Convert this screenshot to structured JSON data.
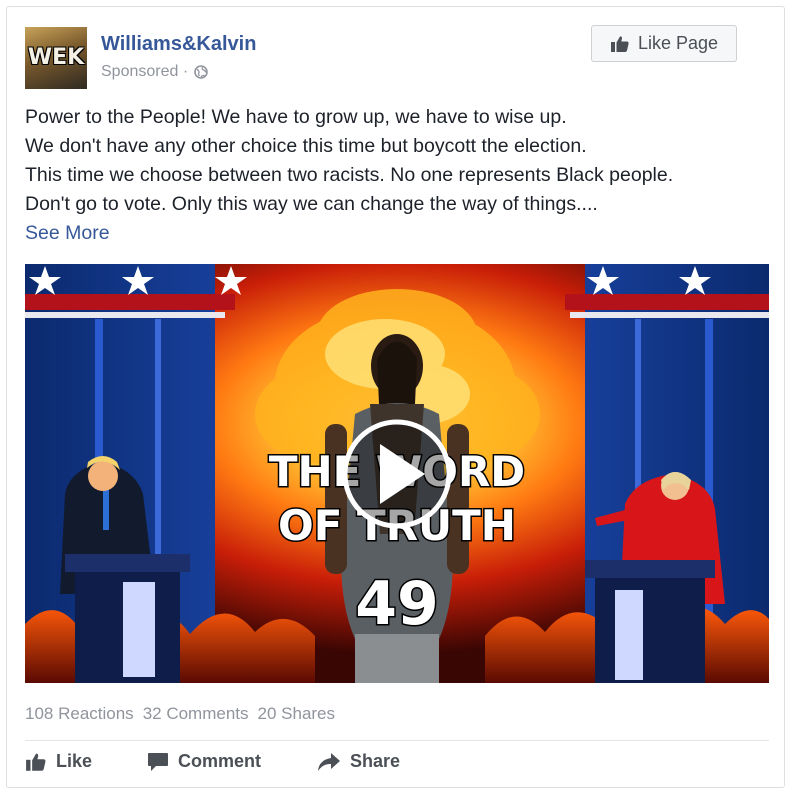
{
  "post": {
    "page_name": "Williams&Kalvin",
    "avatar_text": "WEK",
    "sponsored_label": "Sponsored ·",
    "like_page_label": "Like Page",
    "text_lines": [
      "Power to the People! We have to grow up, we have to wise up.",
      "We don't have any other choice this time but boycott the election.",
      "This time we choose between two racists. No one represents Black people.",
      "Don't go to vote. Only this way we can change the way of things...."
    ],
    "see_more_label": "See More",
    "video": {
      "title_line1": "THE WORD",
      "title_line2": "OF TRUTH",
      "episode": "49"
    },
    "counts": {
      "reactions": "108 Reactions",
      "comments": "32 Comments",
      "shares": "20 Shares"
    },
    "actions": {
      "like": "Like",
      "comment": "Comment",
      "share": "Share"
    }
  },
  "colors": {
    "link_blue": "#365899",
    "meta_gray": "#90949c",
    "action_gray": "#4b4f56"
  },
  "icons": [
    "globe-icon",
    "thumbs-up-icon",
    "play-icon",
    "comment-icon",
    "share-icon"
  ]
}
